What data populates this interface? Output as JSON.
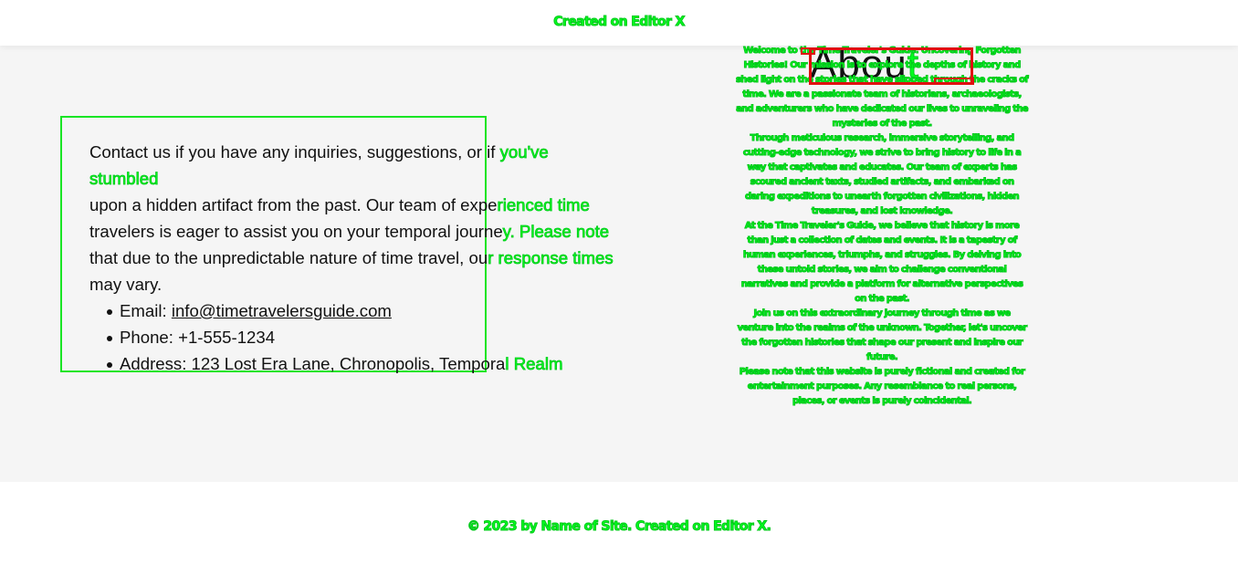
{
  "banner": {
    "text": "Created on Editor X"
  },
  "nav_peek": {
    "text": "— - - - - - - -"
  },
  "contact": {
    "intro_a": "Contact us if you have any inquiries, suggestions, or if ",
    "intro_b": "you've stumbled",
    "line2_a": "upon a hidden artifact from the past. Our team of expe",
    "line2_b": "rienced time",
    "line3_a": "travelers is eager to assist you on your temporal journe",
    "line3_b": "y. Please note",
    "line4_a": "that due to the unpredictable nature of time travel, ou",
    "line4_b": "r response times",
    "line5": "may vary.",
    "email_label": "Email: ",
    "email_value": "info@timetravelersguide.com",
    "phone": "Phone: +1-555-1234",
    "address_a": "Address: 123 Lost Era Lane, Chronopolis, Tempora",
    "address_b": "l Realm"
  },
  "about": {
    "heading_a": "Abou",
    "heading_b": "t",
    "paragraphs": [
      "Welcome to the Time Traveler's Guide: Uncovering Forgotten Histories! Our mission is to explore the depths of history and shed light on the stories that have slipped through the cracks of time. We are a passionate team of historians, archaeologists, and adventurers who have dedicated our lives to unraveling the mysteries of the past.",
      "Through meticulous research, immersive storytelling, and cutting-edge technology, we strive to bring history to life in a way that captivates and educates. Our team of experts has scoured ancient texts, studied artifacts, and embarked on daring expeditions to unearth forgotten civilizations, hidden treasures, and lost knowledge.",
      "At the Time Traveler's Guide, we believe that history is more than just a collection of dates and events. It is a tapestry of human experiences, triumphs, and struggles. By delving into these untold stories, we aim to challenge conventional narratives and provide a platform for alternative perspectives on the past.",
      "Join us on this extraordinary journey through time as we venture into the realms of the unknown. Together, let's uncover the forgotten histories that shape our present and inspire our future.",
      "Please note that this website is purely fictional and created for entertainment purposes. Any resemblance to real persons, places, or events is purely coincidental."
    ]
  },
  "footer": {
    "text": "© 2023 by Name of Site. Created on Editor X."
  }
}
